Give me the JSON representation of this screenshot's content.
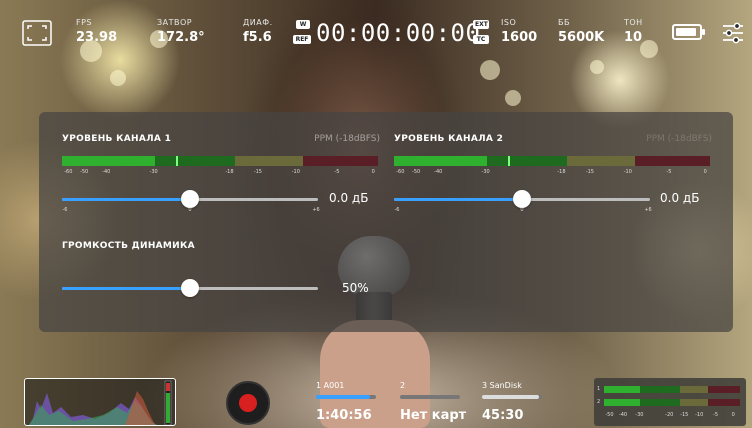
{
  "top_bar": {
    "stats": [
      {
        "label": "FPS",
        "value": "23.98"
      },
      {
        "label": "ЗАТВОР",
        "value": "172.8°"
      },
      {
        "label": "ДИАФ.",
        "value": "f5.6"
      },
      {
        "label": "ISO",
        "value": "1600"
      },
      {
        "label": "ББ",
        "value": "5600K"
      },
      {
        "label": "ТОН",
        "value": "10"
      }
    ],
    "timecode": "00:00:00:00",
    "badges": {
      "w": "W",
      "ref": "REF",
      "ext": "EXT",
      "tc": "TC"
    },
    "battery_level": 0.9
  },
  "audio_panel": {
    "channel1": {
      "title": "УРОВЕНЬ КАНАЛА 1",
      "mode": "PPM (-18dBFS)",
      "gain": "0.0 дБ",
      "slider_fraction": 0.5,
      "peak_fraction": 0.36
    },
    "channel2": {
      "title": "УРОВЕНЬ КАНАЛА 2",
      "mode": "PPM (-18dBFS)",
      "gain": "0.0 дБ",
      "slider_fraction": 0.5,
      "peak_fraction": 0.36
    },
    "meter_scale": [
      "-60",
      "-50",
      "-40",
      "-30",
      "-18",
      "-15",
      "-10",
      "-5",
      "0"
    ],
    "slider_ticks": {
      "min": "-6",
      "mid": "0",
      "max": "+6"
    },
    "speaker": {
      "title": "ГРОМКОСТЬ ДИНАМИКА",
      "value": "50%",
      "fraction": 0.5
    }
  },
  "bottom_bar": {
    "cards": [
      {
        "name": "1  A001",
        "value": "1:40:56",
        "fill": 0.9,
        "color": "#3aa0ff"
      },
      {
        "name": "2",
        "value": "Нет карт",
        "fill": 0.0,
        "color": "#bbbbbb"
      },
      {
        "name": "3  SanDisk",
        "value": "45:30",
        "fill": 0.95,
        "color": "#dddddd"
      }
    ],
    "mini_meter": {
      "channels": [
        "1",
        "2"
      ],
      "scale": [
        "-50",
        "-40",
        "-30",
        "-20",
        "-15",
        "-10",
        "-5",
        "0"
      ]
    }
  }
}
